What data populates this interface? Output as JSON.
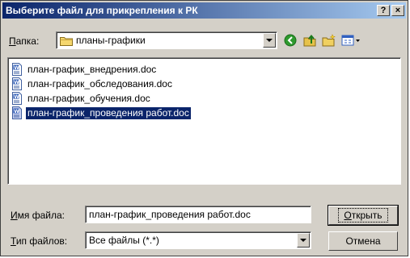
{
  "window": {
    "title": "Выберите файл для прикрепления к РК",
    "help_label": "?",
    "close_label": "×"
  },
  "location": {
    "label_underlined": "П",
    "label_rest": "апка:",
    "value": "планы-графики",
    "icon": "folder-icon"
  },
  "toolbar": [
    {
      "name": "back-icon",
      "color": "#2e9a2e"
    },
    {
      "name": "up-folder-icon",
      "color": "#e6c24a"
    },
    {
      "name": "new-folder-icon",
      "color": "#f0d060"
    },
    {
      "name": "view-menu-icon",
      "color": "#3060c0"
    }
  ],
  "files": [
    {
      "name": "план-график_внедрения.doc",
      "selected": false
    },
    {
      "name": "план-график_обследования.doc",
      "selected": false
    },
    {
      "name": "план-график_обучения.doc",
      "selected": false
    },
    {
      "name": "план-график_проведения работ.doc",
      "selected": true
    }
  ],
  "filename": {
    "label_underlined": "И",
    "label_rest": "мя файла:",
    "value": "план-график_проведения работ.doc"
  },
  "filetype": {
    "label_underlined": "Т",
    "label_rest": "ип файлов:",
    "value": "Все файлы (*.*)"
  },
  "buttons": {
    "open_underlined": "О",
    "open_rest": "ткрыть",
    "cancel": "Отмена"
  }
}
